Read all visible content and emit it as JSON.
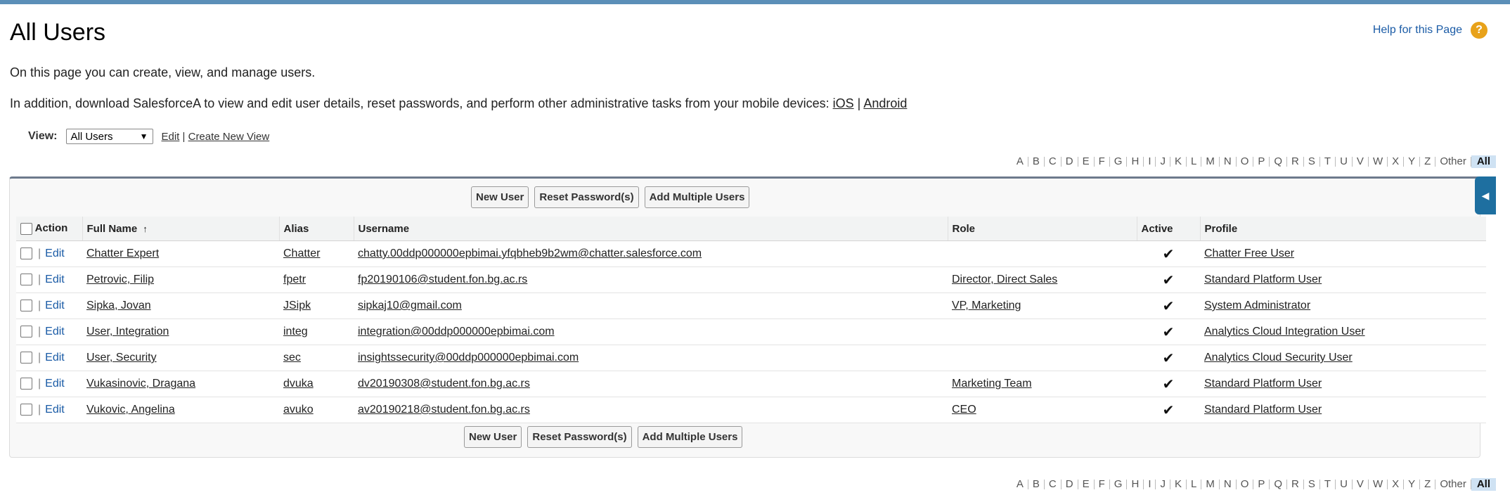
{
  "page": {
    "title": "All Users",
    "help_link": "Help for this Page",
    "help_icon": "?",
    "description1": "On this page you can create, view, and manage users.",
    "description2_prefix": "In addition, download SalesforceA to view and edit user details, reset passwords, and perform other administrative tasks from your mobile devices: ",
    "ios_link": "iOS",
    "divider": "|",
    "android_link": "Android"
  },
  "view": {
    "label": "View:",
    "selected": "All Users",
    "edit_link": "Edit",
    "create_link": "Create New View"
  },
  "alphabet": [
    "A",
    "B",
    "C",
    "D",
    "E",
    "F",
    "G",
    "H",
    "I",
    "J",
    "K",
    "L",
    "M",
    "N",
    "O",
    "P",
    "Q",
    "R",
    "S",
    "T",
    "U",
    "V",
    "W",
    "X",
    "Y",
    "Z",
    "Other",
    "All"
  ],
  "buttons": {
    "new_user": "New User",
    "reset_password": "Reset Password(s)",
    "add_multiple": "Add Multiple Users"
  },
  "table": {
    "headers": {
      "action": "Action",
      "full_name": "Full Name",
      "alias": "Alias",
      "username": "Username",
      "role": "Role",
      "active": "Active",
      "profile": "Profile"
    },
    "sort_indicator": "↑",
    "edit_label": "Edit",
    "check_mark": "✔",
    "rows": [
      {
        "full_name": "Chatter Expert",
        "alias": "Chatter",
        "username": "chatty.00ddp000000epbimai.yfqbheb9b2wm@chatter.salesforce.com",
        "role": "",
        "active": true,
        "profile": "Chatter Free User"
      },
      {
        "full_name": "Petrovic, Filip",
        "alias": "fpetr",
        "username": "fp20190106@student.fon.bg.ac.rs",
        "role": "Director, Direct Sales",
        "active": true,
        "profile": "Standard Platform User"
      },
      {
        "full_name": "Sipka, Jovan",
        "alias": "JSipk",
        "username": "sipkaj10@gmail.com",
        "role": "VP, Marketing",
        "active": true,
        "profile": "System Administrator"
      },
      {
        "full_name": "User, Integration",
        "alias": "integ",
        "username": "integration@00ddp000000epbimai.com",
        "role": "",
        "active": true,
        "profile": "Analytics Cloud Integration User"
      },
      {
        "full_name": "User, Security",
        "alias": "sec",
        "username": "insightssecurity@00ddp000000epbimai.com",
        "role": "",
        "active": true,
        "profile": "Analytics Cloud Security User"
      },
      {
        "full_name": "Vukasinovic, Dragana",
        "alias": "dvuka",
        "username": "dv20190308@student.fon.bg.ac.rs",
        "role": "Marketing Team",
        "active": true,
        "profile": "Standard Platform User"
      },
      {
        "full_name": "Vukovic, Angelina",
        "alias": "avuko",
        "username": "av20190218@student.fon.bg.ac.rs",
        "role": "CEO",
        "active": true,
        "profile": "Standard Platform User"
      }
    ]
  }
}
